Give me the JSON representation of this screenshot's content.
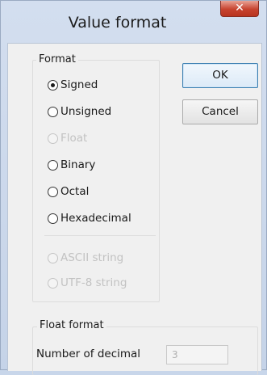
{
  "dialog": {
    "title": "Value format",
    "close_glyph": "✕"
  },
  "format_group": {
    "label": "Format",
    "options": [
      {
        "label": "Signed",
        "checked": true,
        "enabled": true
      },
      {
        "label": "Unsigned",
        "checked": false,
        "enabled": true
      },
      {
        "label": "Float",
        "checked": false,
        "enabled": false
      },
      {
        "label": "Binary",
        "checked": false,
        "enabled": true
      },
      {
        "label": "Octal",
        "checked": false,
        "enabled": true
      },
      {
        "label": "Hexadecimal",
        "checked": false,
        "enabled": true
      },
      {
        "label": "ASCII string",
        "checked": false,
        "enabled": false
      },
      {
        "label": "UTF-8 string",
        "checked": false,
        "enabled": false
      }
    ]
  },
  "buttons": {
    "ok": "OK",
    "cancel": "Cancel"
  },
  "float_group": {
    "label": "Float format",
    "decimals_label": "Number of decimal",
    "decimals_value": "3"
  }
}
